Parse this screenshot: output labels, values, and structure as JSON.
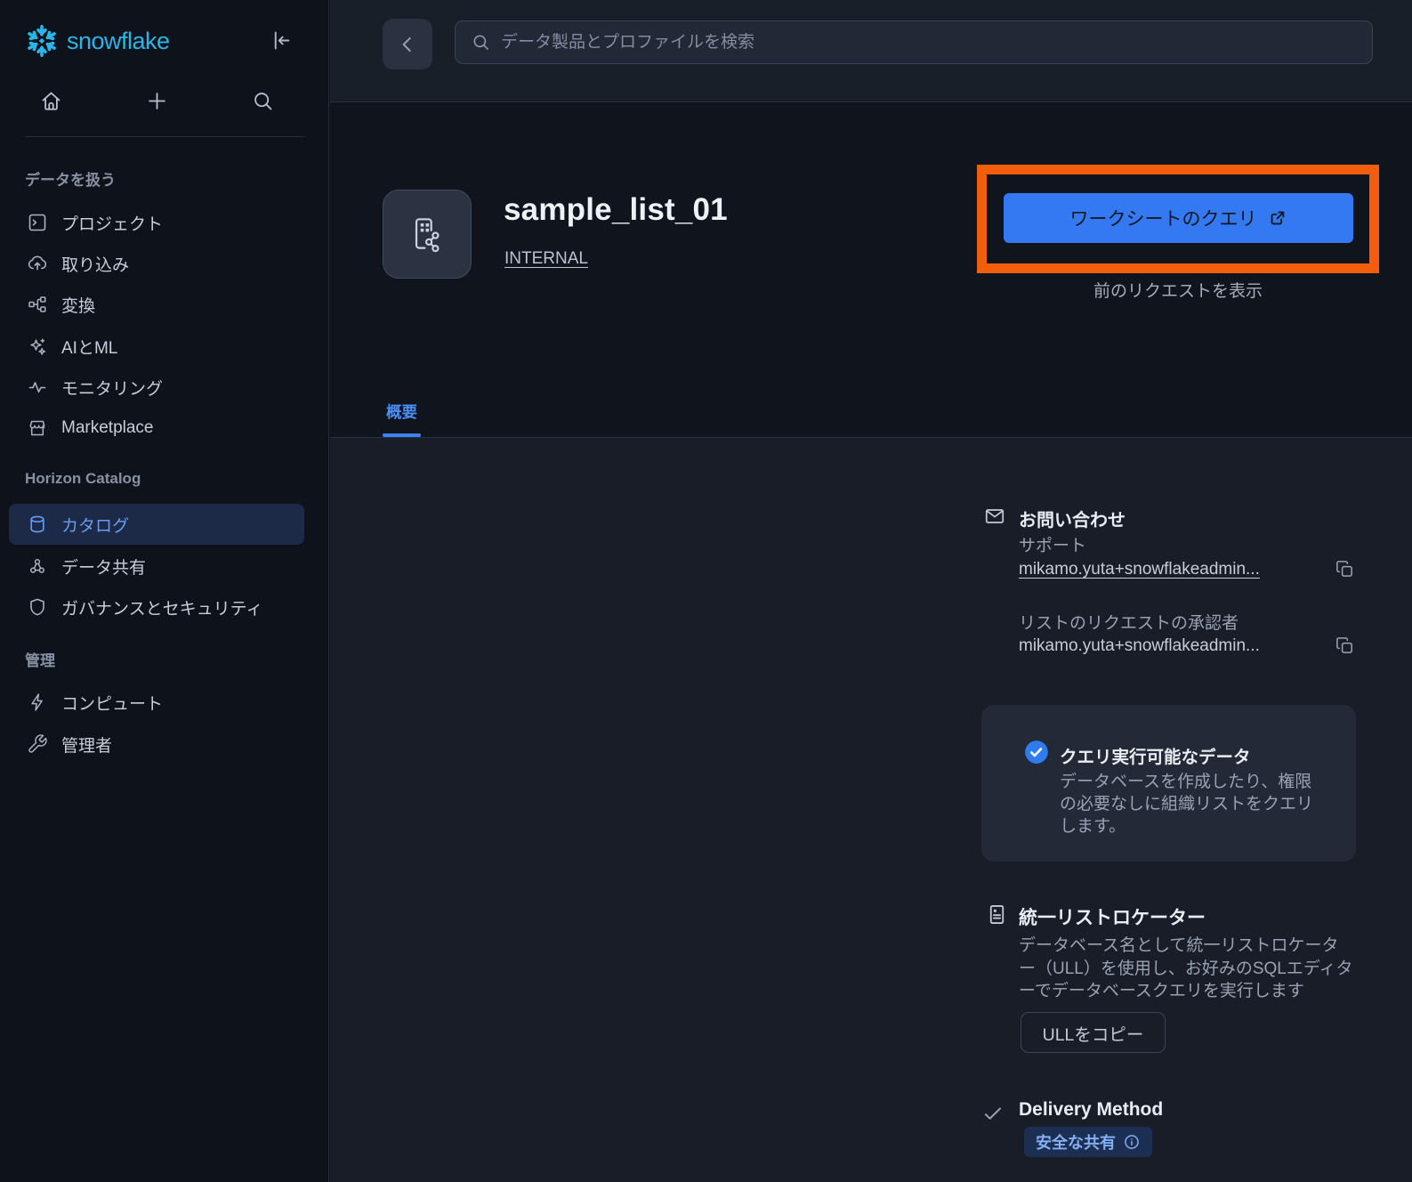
{
  "colors": {
    "brand_cyan": "#29b5e8",
    "accent_blue": "#3478f2",
    "tab_blue": "#4a8ef8",
    "selected_nav_bg": "#1c2947",
    "annotation_orange": "#f25e0b",
    "badge_bg": "#1c2f52",
    "badge_text": "#85aff5",
    "page_bg": "#0f141d",
    "content_bg": "#181d27",
    "card_bg": "#232936"
  },
  "sidebar": {
    "logo_text": "snowflake",
    "sections": [
      {
        "label": "データを扱う",
        "items": [
          {
            "label": "プロジェクト"
          },
          {
            "label": "取り込み"
          },
          {
            "label": "変換"
          },
          {
            "label": "AIとML"
          },
          {
            "label": "モニタリング"
          },
          {
            "label": "Marketplace"
          }
        ]
      },
      {
        "label": "Horizon Catalog",
        "items": [
          {
            "label": "カタログ",
            "active": true
          },
          {
            "label": "データ共有"
          },
          {
            "label": "ガバナンスとセキュリティ"
          }
        ]
      },
      {
        "label": "管理",
        "items": [
          {
            "label": "コンピュート"
          },
          {
            "label": "管理者"
          }
        ]
      }
    ]
  },
  "topbar": {
    "search_placeholder": "データ製品とプロファイルを検索"
  },
  "header": {
    "title": "sample_list_01",
    "provider_link": "INTERNAL",
    "primary_button": "ワークシートのクエリ",
    "previous_requests_link": "前のリクエストを表示"
  },
  "tabs": [
    {
      "label": "概要",
      "active": true
    }
  ],
  "details": {
    "contact": {
      "title": "お問い合わせ",
      "support_label": "サポート",
      "support_email": "mikamo.yuta+snowflakeadmin...",
      "approver_label": "リストのリクエストの承認者",
      "approver_email": "mikamo.yuta+snowflakeadmin..."
    },
    "queryable": {
      "title": "クエリ実行可能なデータ",
      "description": "データベースを作成したり、権限の必要なしに組織リストをクエリします。"
    },
    "ull": {
      "title": "統一リストロケーター",
      "description": "データベース名として統一リストロケーター（ULL）を使用し、お好みのSQLエディターでデータベースクエリを実行します",
      "copy_button": "ULLをコピー"
    },
    "delivery": {
      "title": "Delivery Method",
      "badge": "安全な共有"
    }
  }
}
